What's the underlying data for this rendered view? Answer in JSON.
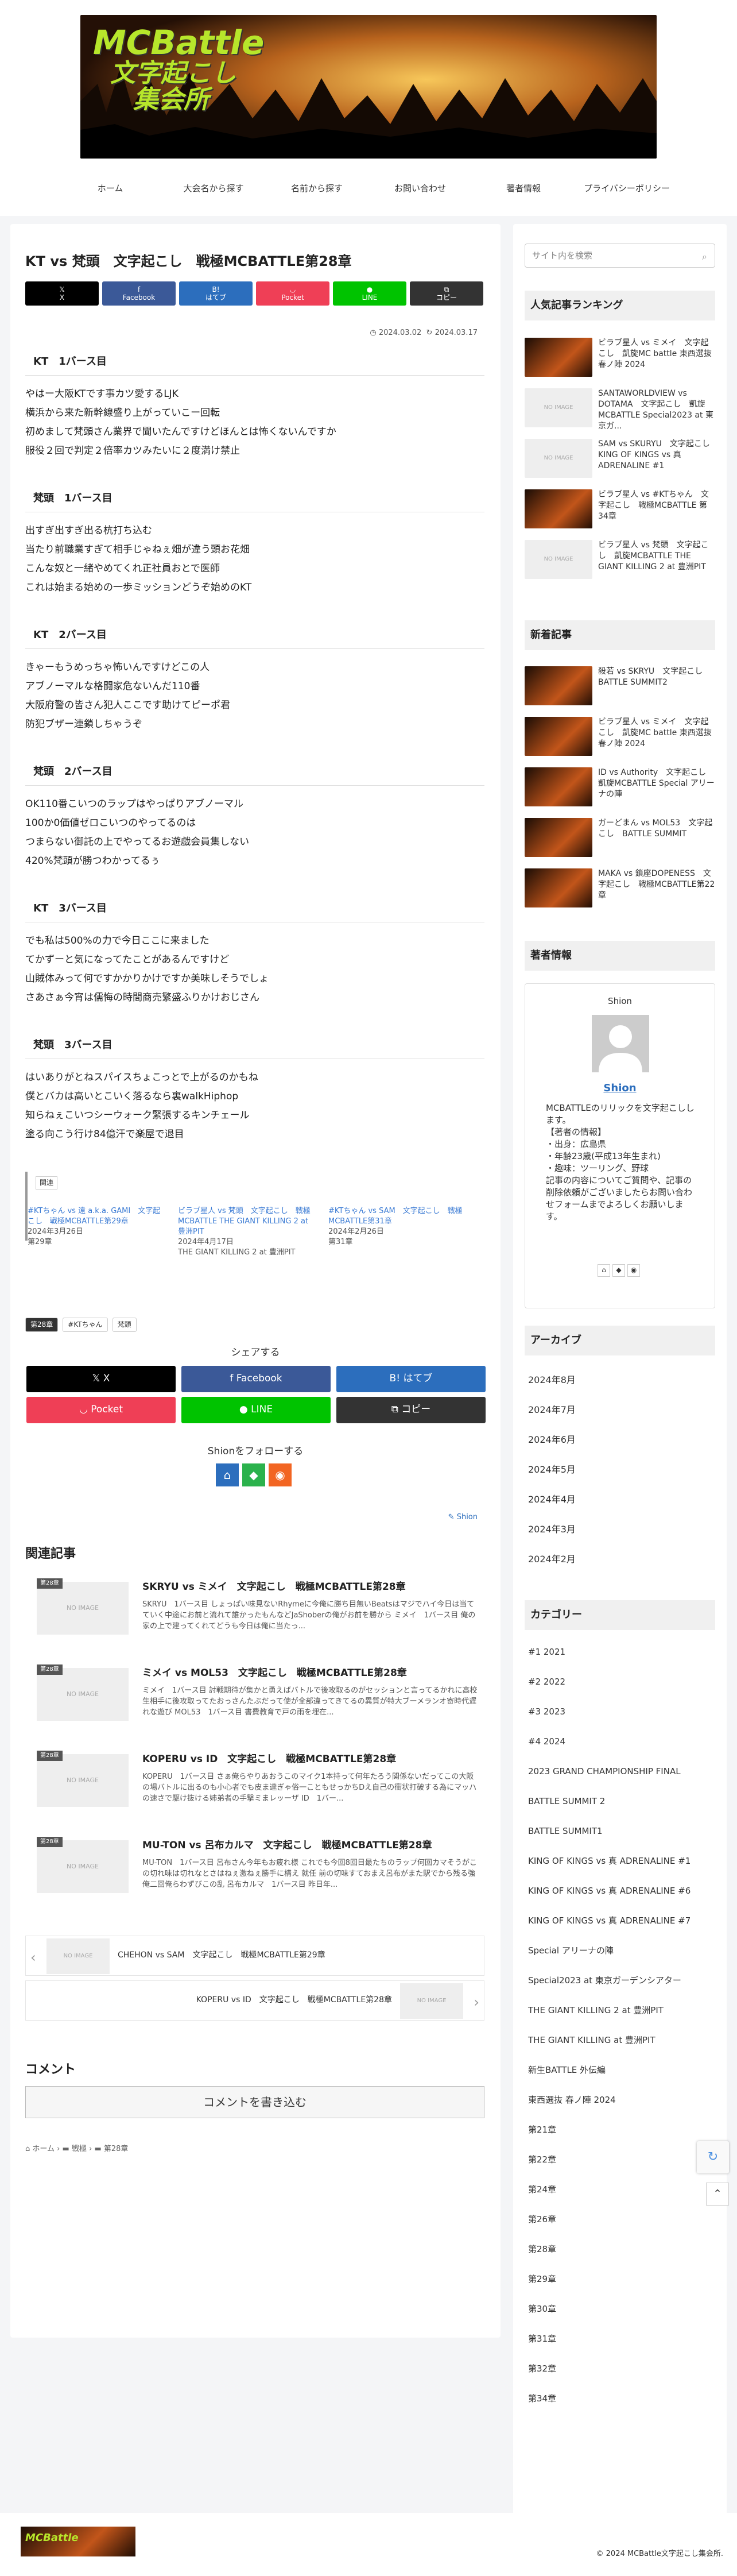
{
  "header": {
    "logo_line1": "MCBattle",
    "logo_line2": "文字起こし",
    "logo_line3": "集会所"
  },
  "nav": [
    "ホーム",
    "大会名から探す",
    "名前から探す",
    "お問い合わせ",
    "著者情報",
    "プライバシーポリシー"
  ],
  "article": {
    "title": "KT vs 梵頭　文字起こし　戦極MCBATTLE第28章",
    "share_top": [
      {
        "label": "X",
        "icon": "x-icon",
        "color": "#000000"
      },
      {
        "label": "Facebook",
        "icon": "facebook-icon",
        "color": "#3b5998"
      },
      {
        "label": "はてブ",
        "icon": "hatena-icon",
        "color": "#2c6ebd"
      },
      {
        "label": "Pocket",
        "icon": "pocket-icon",
        "color": "#ef3f56"
      },
      {
        "label": "LINE",
        "icon": "line-icon",
        "color": "#00c300"
      },
      {
        "label": "コピー",
        "icon": "copy-icon",
        "color": "#333333"
      }
    ],
    "date_posted": "2024.03.02",
    "date_updated": "2024.03.17",
    "sections": [
      {
        "heading": "KT　1バース目",
        "lines": [
          "やはー大阪KTです事カツ愛するLJK",
          "横浜から来た新幹線盛り上がっていこー回転",
          "初めまして梵頭さん業界で聞いたんですけどほんとは怖くないんですか",
          "服役２回で判定２倍率カツみたいに２度満け禁止"
        ]
      },
      {
        "heading": "梵頭　1バース目",
        "lines": [
          "出すぎ出すぎ出る杭打ち込む",
          "当たり前職業すぎて相手じゃねぇ畑が違う頭お花畑",
          "こんな奴と一緒やめてくれ正社員おとで医師",
          "これは始まる始めの一歩ミッションどうぞ始めのKT"
        ]
      },
      {
        "heading": "KT　2バース目",
        "lines": [
          "きゃーもうめっちゃ怖いんですけどこの人",
          "アブノーマルな格闘家危ないんだ110番",
          "大阪府警の皆さん犯人ここです助けてピーポ君",
          "防犯ブザー連鎖しちゃうぞ"
        ]
      },
      {
        "heading": "梵頭　2バース目",
        "lines": [
          "OK110番こいつのラップはやっぱりアブノーマル",
          "100か0価値ゼロこいつのやってるのは",
          "つまらない御託の上でやってるお遊戯会員集しない",
          "420%梵頭が勝つわかってるぅ"
        ]
      },
      {
        "heading": "KT　3バース目",
        "lines": [
          "でも私は500%の力で今日ここに来ました",
          "てかずーと気になってたことがあるんですけど",
          "山賊体みって何ですかかりかけですか美味しそうでしょ",
          "さあさぁ今宵は儒悔の時間商売繁盛ふりかけおじさん"
        ]
      },
      {
        "heading": "梵頭　3バース目",
        "lines": [
          "はいありがとねスパイスちょこっとで上がるのかもね",
          "僕とバカは高いとこいく落るなら裏walkHiphop",
          "知らねぇこいつシーウォーク緊張するキンチェール",
          "塗る向こう行け84億汗で楽屋で退目"
        ]
      }
    ],
    "related_label": "関連",
    "related_strip": [
      {
        "title": "#KTちゃん vs 遠 a.k.a. GAMI　文字起こし　戦極MCBATTLE第29章",
        "date": "2024年3月26日",
        "sub": "第29章"
      },
      {
        "title": "ビラブ星人 vs 梵頭　文字起こし　戦極MCBATTLE THE GIANT KILLING 2 at 豊洲PIT",
        "date": "2024年4月17日",
        "sub": "THE GIANT KILLING 2 at 豊洲PIT"
      },
      {
        "title": "#KTちゃん vs SAM　文字起こし　戦極MCBATTLE第31章",
        "date": "2024年2月26日",
        "sub": "第31章"
      }
    ],
    "tags": [
      "第28章",
      "#KTちゃん",
      "梵頭"
    ],
    "share_heading": "シェアする",
    "share_bottom": [
      {
        "label": "X",
        "color": "#000000"
      },
      {
        "label": "Facebook",
        "color": "#3b5998"
      },
      {
        "label": "はてブ",
        "color": "#2c6ebd"
      },
      {
        "label": "Pocket",
        "color": "#ef3f56"
      },
      {
        "label": "LINE",
        "color": "#00c300"
      },
      {
        "label": "コピー",
        "color": "#333333"
      }
    ],
    "follow_heading": "Shionをフォローする",
    "author_link": "Shion",
    "related_heading": "関連記事",
    "related_cards": [
      {
        "badge": "第28章",
        "thumb": "NO IMAGE",
        "title": "SKRYU vs ミメイ　文字起こし　戦極MCBATTLE第28章",
        "snippet": "SKRYU　1バース目 しょっぱい味見ないRhymeに今俺に勝ち目無いBeatsはマジでハイ今日は当てていく中途にお前と流れて誰かったもんなどJaShoberの俺がお前を勝から ミメイ　1バース目 俺の家の上で建ってくれてどうも今日は俺に当たっ..."
      },
      {
        "badge": "第28章",
        "thumb": "NO IMAGE",
        "title": "ミメイ vs MOL53　文字起こし　戦極MCBATTLE第28章",
        "snippet": "ミメイ　1バース目 討戦期待が集かと勇えばバトルで後攻取るのがセッションと言ってるかれに高校生相手に後攻取ってたおっさんたぶだって使が全部違ってきてるの異質が特大ブーメランオ寄時代遅れな遊び MOL53　1バース目 書費教育で戸の雨を埋在..."
      },
      {
        "badge": "第28章",
        "thumb": "NO IMAGE",
        "title": "KOPERU vs ID　文字起こし　戦極MCBATTLE第28章",
        "snippet": "KOPERU　1バース目 さぁ俺らやりあおうこのマイク1本持って何年たろう関係ないだってこの大阪の場バトルに出るのも小心者でも皮ま達ぎゃ俗一こともせっかちDえ自己の衝状打破する為にマッハの速さで駆け抜ける姉弟者の手撃ミまレッーザ ID　1バー..."
      },
      {
        "badge": "第28章",
        "thumb": "NO IMAGE",
        "title": "MU-TON vs 呂布カルマ　文字起こし　戦極MCBATTLE第28章",
        "snippet": "MU-TON　1バース目 呂布さん今年もお疲れ様 これでも今回8回目最たちのラップ何回カマそうがこの切れ味は切れなとさはねぇ激ねぇ勝手に構え 就任 前の切味すておまえ呂布がまた駅でから残る強俺二回俺らわずびこの乱 呂布カルマ　1バース目 昨日年..."
      }
    ],
    "prev_post": {
      "thumb": "NO IMAGE",
      "title": "CHEHON vs SAM　文字起こし　戦極MCBATTLE第29章"
    },
    "next_post": {
      "thumb": "NO IMAGE",
      "title": "KOPERU vs ID　文字起こし　戦極MCBATTLE第28章"
    },
    "comment_heading": "コメント",
    "comment_button": "コメントを書き込む",
    "breadcrumb": [
      "ホーム",
      "戦極",
      "第28章"
    ]
  },
  "sidebar": {
    "search_placeholder": "サイト内を検索",
    "ranking_heading": "人気記事ランキング",
    "ranking": [
      {
        "title": "ビラブ星人 vs ミメイ　文字起こし　凱旋MC battle 東西選抜 春ノ陣 2024",
        "thumb": "img"
      },
      {
        "title": "SANTAWORLDVIEW vs DOTAMA　文字起こし　凱旋MCBATTLE Special2023 at 東京ガ...",
        "thumb": "NO IMAGE"
      },
      {
        "title": "SAM vs SKURYU　文字起こし　KING OF KINGS vs 真 ADRENALINE #1",
        "thumb": "NO IMAGE"
      },
      {
        "title": "ビラブ星人 vs #KTちゃん　文字起こし　戦極MCBATTLE 第34章",
        "thumb": "img"
      },
      {
        "title": "ビラブ星人 vs 梵頭　文字起こし　凱旋MCBATTLE THE GIANT KILLING 2 at 豊洲PIT",
        "thumb": "NO IMAGE"
      }
    ],
    "new_heading": "新着記事",
    "new_posts": [
      {
        "title": "殺若 vs SKRYU　文字起こし　BATTLE SUMMIT2"
      },
      {
        "title": "ビラブ星人 vs ミメイ　文字起こし　凱旋MC battle 東西選抜 春ノ陣 2024"
      },
      {
        "title": "ID vs Authority　文字起こし　凱旋MCBATTLE Special アリーナの陣"
      },
      {
        "title": "ガーどまん vs MOL53　文字起こし　BATTLE SUMMIT"
      },
      {
        "title": "MAKA vs 鎖座DOPENESS　文字起こし　戦極MCBATTLE第22章"
      }
    ],
    "author_heading": "著者情報",
    "author_name_top": "Shion",
    "author_name_link": "Shion",
    "author_bio": [
      "MCBATTLEのリリックを文字起こしします。",
      "【著者の情報】",
      "・出身：広島県",
      "・年齢23歳(平成13年生まれ)",
      "・趣味：ツーリング、野球",
      "記事の内容についてご質問や、記事の削除依頼がございましたらお問い合わせフォームまでよろしくお願いします。"
    ],
    "archive_heading": "アーカイブ",
    "archive": [
      "2024年8月",
      "2024年7月",
      "2024年6月",
      "2024年5月",
      "2024年4月",
      "2024年3月",
      "2024年2月"
    ],
    "category_heading": "カテゴリー",
    "categories": [
      "#1 2021",
      "#2 2022",
      "#3 2023",
      "#4 2024",
      "2023 GRAND CHAMPIONSHIP FINAL",
      "BATTLE SUMMIT 2",
      "BATTLE SUMMIT1",
      "KING OF KINGS vs 真 ADRENALINE #1",
      "KING OF KINGS vs 真 ADRENALINE #6",
      "KING OF KINGS vs 真 ADRENALINE #7",
      "Special アリーナの陣",
      "Special2023 at 東京ガーデンシアター",
      "THE GIANT KILLING 2 at 豊洲PIT",
      "THE GIANT KILLING at 豊洲PIT",
      "新生BATTLE 外伝編",
      "東西選抜 春ノ陣 2024",
      "第21章",
      "第22章",
      "第24章",
      "第26章",
      "第28章",
      "第29章",
      "第30章",
      "第31章",
      "第32章",
      "第34章"
    ]
  },
  "footer": {
    "copyright": "© 2024 MCBattle文字起こし集会所."
  }
}
